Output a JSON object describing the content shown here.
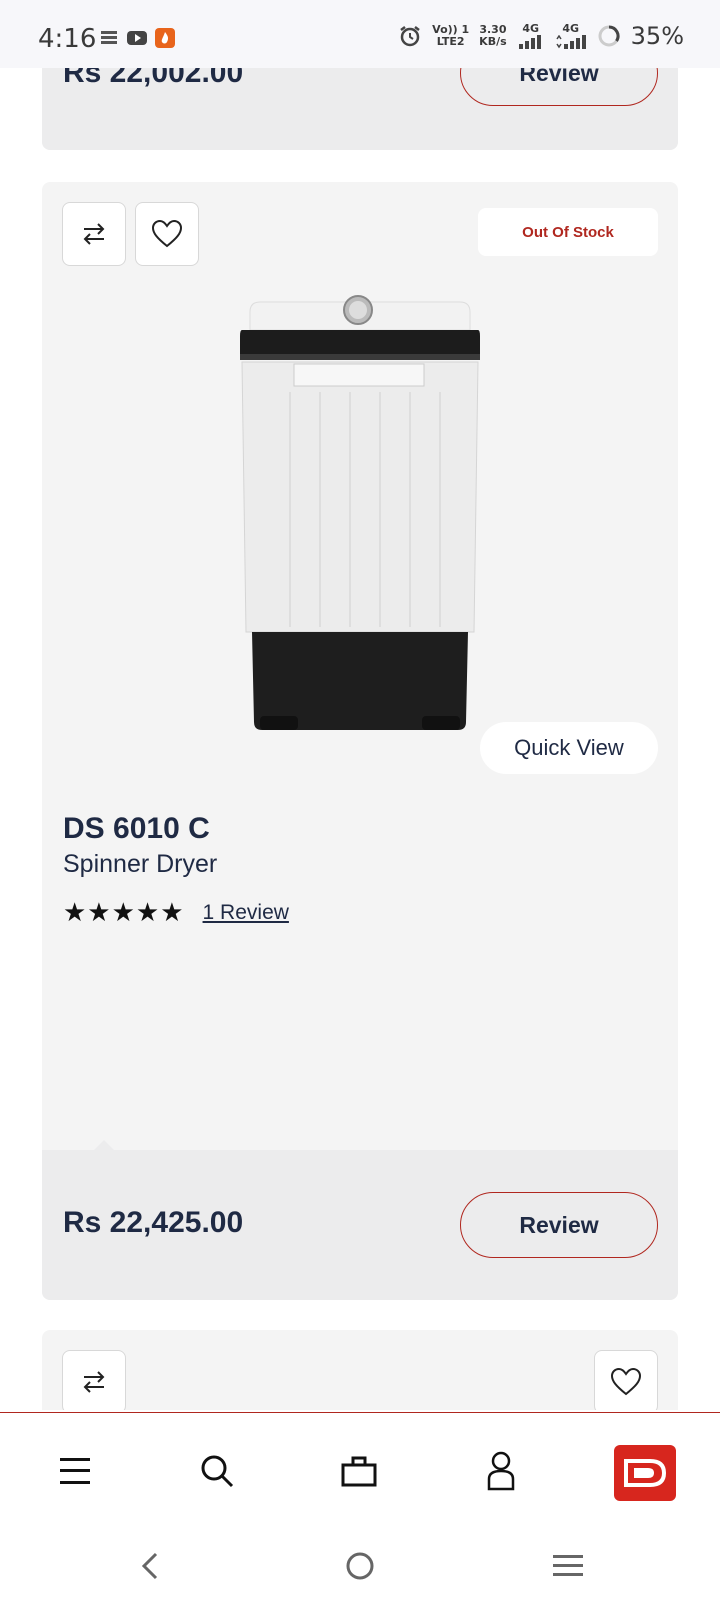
{
  "status_bar": {
    "time": "4:16",
    "volte": "Vo)) 1",
    "lte": "LTE2",
    "speed_value": "3.30",
    "speed_unit": "KB/s",
    "signal1_label": "4G",
    "signal2_label": "4G",
    "battery": "35%"
  },
  "previous_card": {
    "price": "Rs 22,002.00",
    "review_label": "Review"
  },
  "product_card": {
    "stock_badge": "Out Of Stock",
    "quick_view_label": "Quick View",
    "model": "DS 6010 C",
    "subtitle": "Spinner Dryer",
    "stars": "★★★★★",
    "rating": 5,
    "review_link": "1 Review",
    "price": "Rs 22,425.00",
    "review_label": "Review"
  },
  "bottom_nav": {
    "items": [
      "menu-icon",
      "search-icon",
      "bag-icon",
      "user-icon",
      "brand-logo"
    ]
  },
  "colors": {
    "accent": "#b0271f",
    "brand": "#d7261e",
    "text": "#1f2a44",
    "card_bg": "#f4f4f4",
    "footer_bg": "#ececed"
  }
}
